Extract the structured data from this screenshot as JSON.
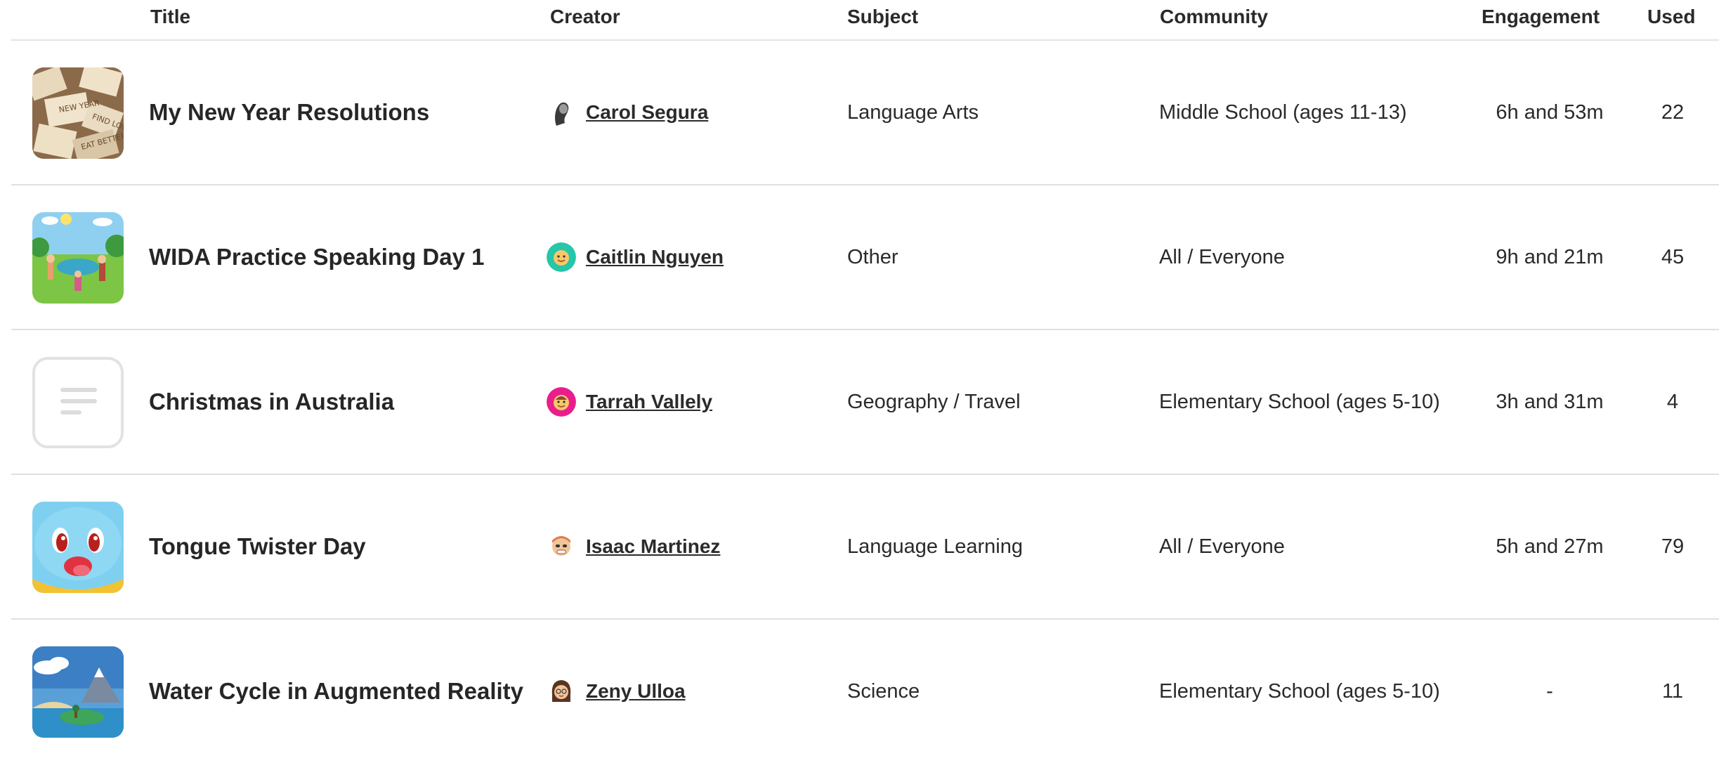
{
  "headers": {
    "title": "Title",
    "creator": "Creator",
    "subject": "Subject",
    "community": "Community",
    "engagement": "Engagement",
    "used": "Used"
  },
  "rows": [
    {
      "title": "My New Year Resolutions",
      "creator": "Carol Segura",
      "subject": "Language Arts",
      "community": "Middle School (ages 11-13)",
      "engagement": "6h and 53m",
      "used": "22",
      "thumbnail_icon": "new-year-notes-thumbnail",
      "avatar_icon": "profile-photo-avatar"
    },
    {
      "title": "WIDA Practice Speaking Day 1",
      "creator": "Caitlin Nguyen",
      "subject": "Other",
      "community": "All / Everyone",
      "engagement": "9h and 21m",
      "used": "45",
      "thumbnail_icon": "park-scene-thumbnail",
      "avatar_icon": "emoji-avatar"
    },
    {
      "title": "Christmas in Australia",
      "creator": "Tarrah Vallely",
      "subject": "Geography / Travel",
      "community": "Elementary School (ages 5-10)",
      "engagement": "3h and 31m",
      "used": "4",
      "thumbnail_icon": "document-placeholder-icon",
      "avatar_icon": "emoji-avatar"
    },
    {
      "title": "Tongue Twister Day",
      "creator": "Isaac Martinez",
      "subject": "Language Learning",
      "community": "All / Everyone",
      "engagement": "5h and 27m",
      "used": "79",
      "thumbnail_icon": "cartoon-character-thumbnail",
      "avatar_icon": "emoji-avatar"
    },
    {
      "title": "Water Cycle in Augmented Reality",
      "creator": "Zeny Ulloa",
      "subject": "Science",
      "community": "Elementary School (ages 5-10)",
      "engagement": "-",
      "used": "11",
      "thumbnail_icon": "water-cycle-thumbnail",
      "avatar_icon": "emoji-avatar"
    }
  ]
}
